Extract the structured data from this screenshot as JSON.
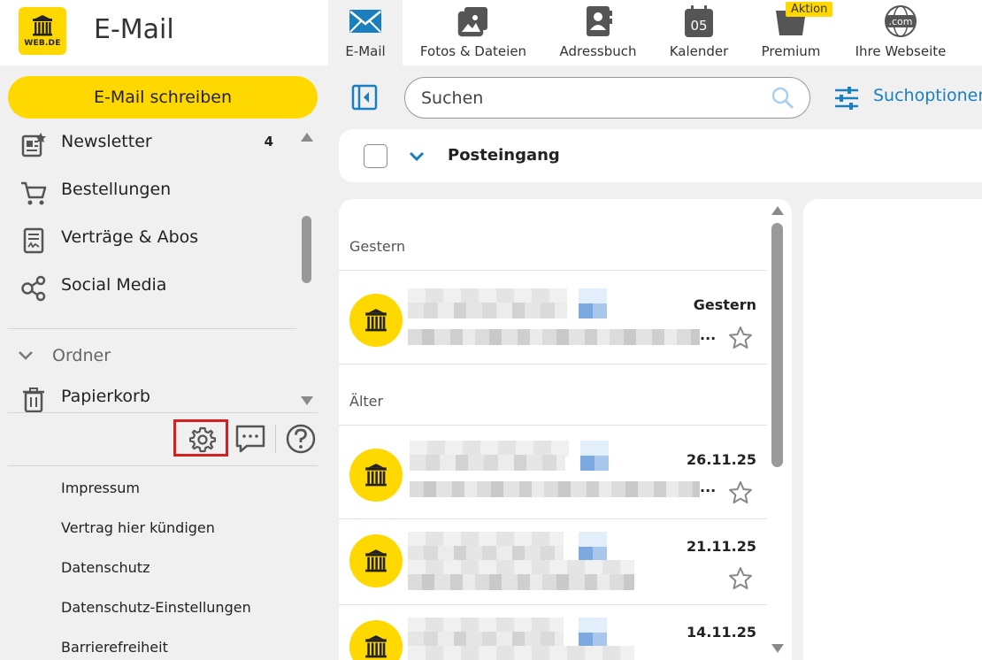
{
  "app": {
    "logo_text": "WEB.DE",
    "title": "E-Mail"
  },
  "nav": {
    "items": [
      {
        "label": "E-Mail",
        "icon": "envelope-icon",
        "active": true
      },
      {
        "label": "Fotos & Dateien",
        "icon": "photos-icon"
      },
      {
        "label": "Adressbuch",
        "icon": "address-book-icon"
      },
      {
        "label": "Kalender",
        "icon": "calendar-icon",
        "calendar_day": "05"
      },
      {
        "label": "Premium",
        "icon": "premium-icon",
        "badge": "Aktion"
      },
      {
        "label": "Ihre Webseite",
        "icon": "globe-com-icon",
        "globe_text": ".com"
      }
    ]
  },
  "sidebar": {
    "compose_label": "E-Mail schreiben",
    "folders": [
      {
        "label": "Newsletter",
        "count": "4",
        "icon": "newsletter-icon"
      },
      {
        "label": "Bestellungen",
        "count": "",
        "icon": "cart-icon"
      },
      {
        "label": "Verträge & Abos",
        "count": "",
        "icon": "contract-icon"
      },
      {
        "label": "Social Media",
        "count": "",
        "icon": "social-icon"
      }
    ],
    "ordner_label": "Ordner",
    "trash_label": "Papierkorb",
    "tools": [
      {
        "name": "settings",
        "icon": "gear-icon",
        "highlighted": true
      },
      {
        "name": "feedback",
        "icon": "chat-icon"
      },
      {
        "name": "help",
        "icon": "help-icon"
      }
    ],
    "footer_links": [
      "Impressum",
      "Vertrag hier kündigen",
      "Datenschutz",
      "Datenschutz-Einstellungen",
      "Barrierefreiheit"
    ]
  },
  "search": {
    "placeholder": "Suchen",
    "options_label": "Suchoptionen"
  },
  "list": {
    "title": "Posteingang",
    "groups": {
      "yesterday": "Gestern",
      "older": "Älter"
    },
    "mails": [
      {
        "date": "Gestern",
        "preview_ellipsis": "..."
      },
      {
        "date": "26.11.25",
        "preview_ellipsis": "..."
      },
      {
        "date": "21.11.25",
        "preview_ellipsis": ""
      },
      {
        "date": "14.11.25",
        "preview_ellipsis": ""
      }
    ]
  },
  "colors": {
    "brand_yellow": "#ffd800",
    "accent_blue": "#1a7fbf",
    "highlight_red": "#d81e1e"
  }
}
